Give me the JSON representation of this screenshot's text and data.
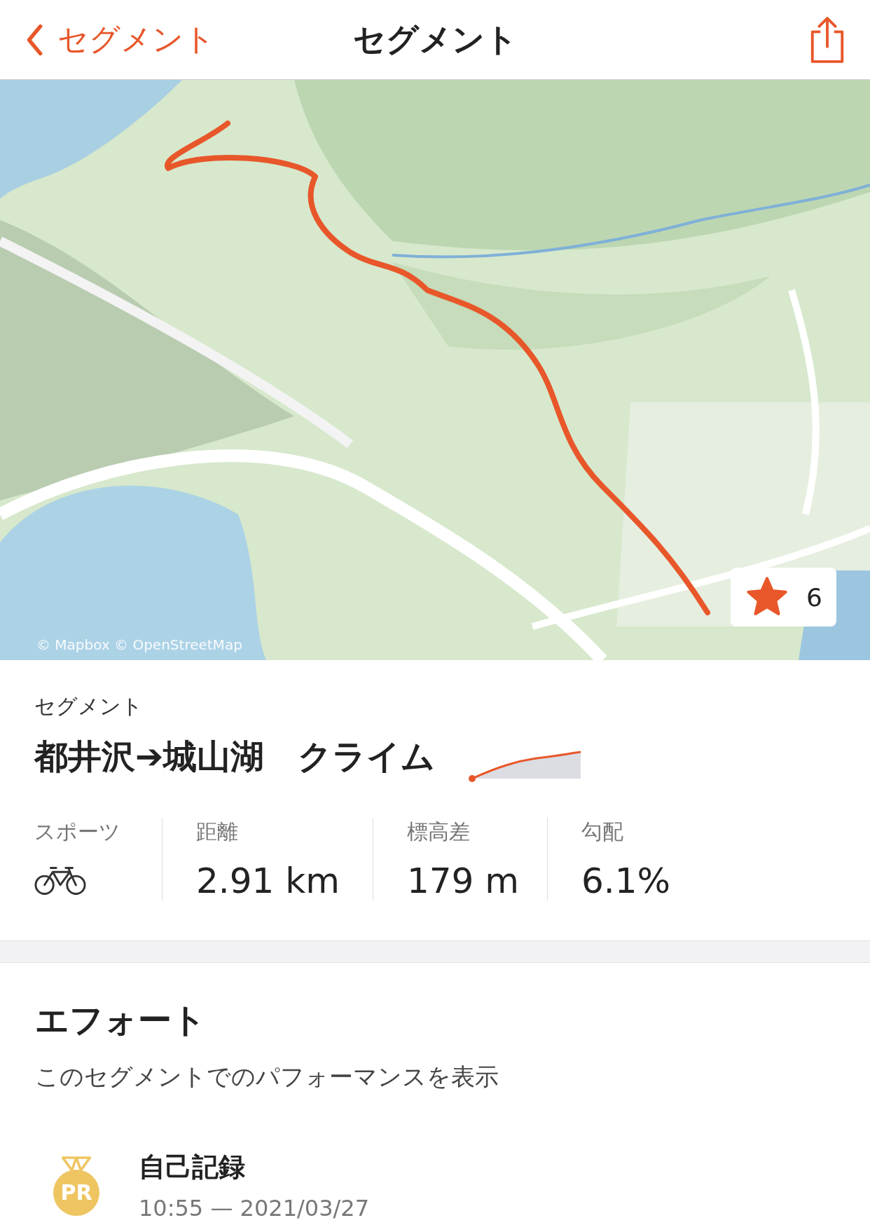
{
  "nav": {
    "back_label": "セグメント",
    "title": "セグメント"
  },
  "map": {
    "kind": "picture",
    "attribution": "© Mapbox © OpenStreetMap",
    "star_count": "6"
  },
  "segment": {
    "caption": "セグメント",
    "name": "都井沢➔城山湖　クライム"
  },
  "stats": [
    {
      "kind": "icon",
      "label": "スポーツ"
    },
    {
      "kind": "value",
      "label": "距離",
      "value": "2.91 km"
    },
    {
      "kind": "value",
      "label": "標高差",
      "value": "179 m"
    },
    {
      "kind": "value",
      "label": "勾配",
      "value": "6.1%"
    }
  ],
  "efforts": {
    "title": "エフォート",
    "subtitle": "このセグメントでのパフォーマンスを表示",
    "records": [
      {
        "badge": "PR",
        "title": "自己記録",
        "detail": "10:55 — 2021/03/27"
      }
    ]
  }
}
